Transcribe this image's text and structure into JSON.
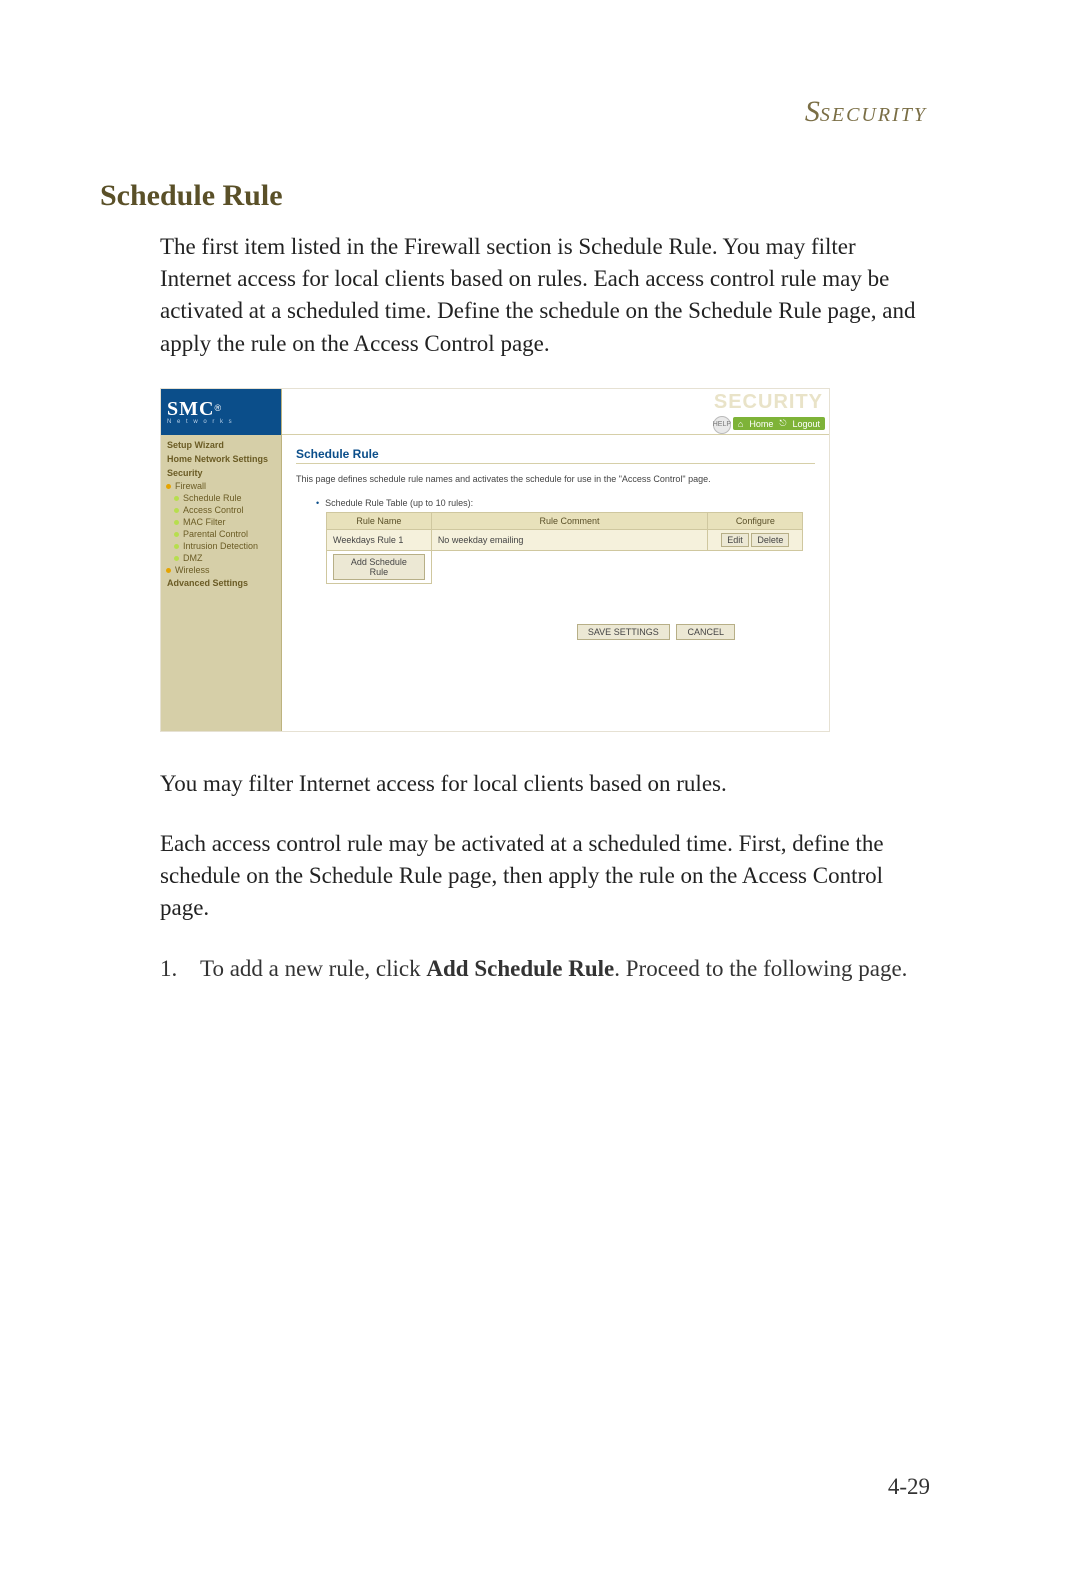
{
  "header_section": "Security",
  "heading": "Schedule Rule",
  "intro_paragraph": "The first item listed in the Firewall section is Schedule Rule. You may filter Internet access for local clients based on rules. Each access control rule may be activated at a scheduled time. Define the schedule on the Schedule Rule page, and apply the rule on the Access Control page.",
  "after_screenshot_p1": "You may filter Internet access for local clients based on rules.",
  "after_screenshot_p2": "Each access control rule may be activated at a scheduled time. First, define the schedule on the Schedule Rule page, then apply the rule on the Access Control page.",
  "step1_num": "1.",
  "step1_prefix": "To add a new rule, click ",
  "step1_bold": "Add Schedule Rule",
  "step1_suffix": ". Proceed to the following page.",
  "page_number": "4-29",
  "screenshot": {
    "logo": "SMC",
    "logo_reg": "®",
    "logo_sub": "N e t w o r k s",
    "topbar_brand": "SECURITY",
    "help_label": "HELP",
    "home_link": "Home",
    "logout_link": "Logout",
    "nav": {
      "setup_wizard": "Setup Wizard",
      "home_network_settings": "Home Network Settings",
      "security": "Security",
      "firewall": "Firewall",
      "schedule_rule": "Schedule Rule",
      "access_control": "Access Control",
      "mac_filter": "MAC Filter",
      "parental_control": "Parental Control",
      "intrusion_detection": "Intrusion Detection",
      "dmz": "DMZ",
      "wireless": "Wireless",
      "advanced_settings": "Advanced Settings"
    },
    "content": {
      "title": "Schedule Rule",
      "desc": "This page defines schedule rule names and activates the schedule for use in the \"Access Control\" page.",
      "table_caption": "Schedule Rule Table (up to 10 rules):",
      "col_rule_name": "Rule Name",
      "col_rule_comment": "Rule Comment",
      "col_configure": "Configure",
      "row1_name": "Weekdays Rule 1",
      "row1_comment": "No weekday emailing",
      "edit_btn": "Edit",
      "delete_btn": "Delete",
      "add_btn": "Add Schedule Rule",
      "save_btn": "SAVE SETTINGS",
      "cancel_btn": "CANCEL"
    }
  }
}
